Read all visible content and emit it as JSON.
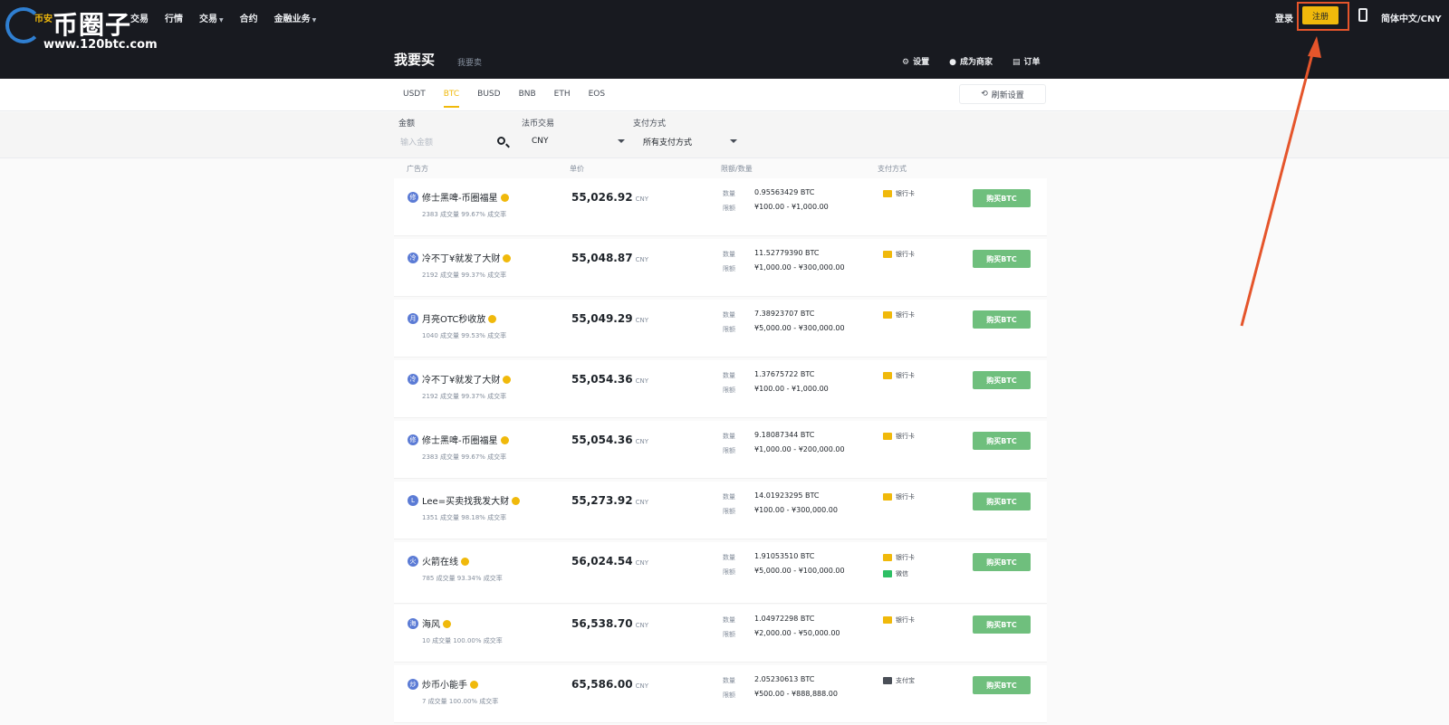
{
  "header": {
    "watermark": {
      "site_name": "币圈子",
      "url": "www.120btc.com",
      "logo_fragment": "币安"
    },
    "nav": [
      {
        "label": "交易",
        "has_caret": false
      },
      {
        "label": "行情",
        "has_caret": false
      },
      {
        "label": "交易",
        "has_caret": true
      },
      {
        "label": "合约",
        "has_caret": false
      },
      {
        "label": "金融业务",
        "has_caret": true
      }
    ],
    "login_label": "登录",
    "register_label": "注册",
    "language_label": "简体中文/CNY",
    "highlight_color": "#e5552b"
  },
  "subheader": {
    "title": "我要买",
    "sell_tab": "我要卖",
    "settings_label": "设置",
    "merchant_label": "成为商家",
    "orders_label": "订单"
  },
  "tabs": {
    "items": [
      "USDT",
      "BTC",
      "BUSD",
      "BNB",
      "ETH",
      "EOS"
    ],
    "active": "BTC",
    "refresh_label": "刷新设置"
  },
  "filters": {
    "amount_label": "金额",
    "amount_placeholder": "输入金额",
    "fiat_label": "法币交易",
    "fiat_value": "CNY",
    "payment_label": "支付方式",
    "payment_value": "所有支付方式"
  },
  "table": {
    "headers": [
      "广告方",
      "单价",
      "限额/数量",
      "支付方式"
    ],
    "currency": "CNY",
    "qty_label": "数量",
    "limit_label": "限额",
    "buy_label": "购买BTC",
    "rows": [
      {
        "avatar": "修",
        "name": "修士黑啤-币圈福星",
        "stats": "2383 成交量  99.67% 成交率",
        "price": "55,026.92",
        "qty": "0.95563429 BTC",
        "limit": "¥100.00 - ¥1,000.00",
        "payments": [
          {
            "name": "银行卡",
            "icon": "bank-card"
          }
        ]
      },
      {
        "avatar": "冷",
        "name": "冷不丁¥就发了大财",
        "stats": "2192 成交量  99.37% 成交率",
        "price": "55,048.87",
        "qty": "11.52779390 BTC",
        "limit": "¥1,000.00 - ¥300,000.00",
        "payments": [
          {
            "name": "银行卡",
            "icon": "bank-card"
          }
        ]
      },
      {
        "avatar": "月",
        "name": "月亮OTC秒收放",
        "stats": "1040 成交量  99.53% 成交率",
        "price": "55,049.29",
        "qty": "7.38923707 BTC",
        "limit": "¥5,000.00 - ¥300,000.00",
        "payments": [
          {
            "name": "银行卡",
            "icon": "bank-card"
          }
        ]
      },
      {
        "avatar": "冷",
        "name": "冷不丁¥就发了大财",
        "stats": "2192 成交量  99.37% 成交率",
        "price": "55,054.36",
        "qty": "1.37675722 BTC",
        "limit": "¥100.00 - ¥1,000.00",
        "payments": [
          {
            "name": "银行卡",
            "icon": "bank-card"
          }
        ]
      },
      {
        "avatar": "修",
        "name": "修士黑啤-币圈福星",
        "stats": "2383 成交量  99.67% 成交率",
        "price": "55,054.36",
        "qty": "9.18087344 BTC",
        "limit": "¥1,000.00 - ¥200,000.00",
        "payments": [
          {
            "name": "银行卡",
            "icon": "bank-card"
          }
        ]
      },
      {
        "avatar": "L",
        "name": "Lee=买卖找我发大财",
        "stats": "1351 成交量  98.18% 成交率",
        "price": "55,273.92",
        "qty": "14.01923295 BTC",
        "limit": "¥100.00 - ¥300,000.00",
        "payments": [
          {
            "name": "银行卡",
            "icon": "bank-card"
          }
        ]
      },
      {
        "avatar": "火",
        "name": "火箭在线",
        "stats": "785 成交量  93.34% 成交率",
        "price": "56,024.54",
        "qty": "1.91053510 BTC",
        "limit": "¥5,000.00 - ¥100,000.00",
        "payments": [
          {
            "name": "银行卡",
            "icon": "bank-card"
          },
          {
            "name": "微信",
            "icon": "wechat"
          }
        ]
      },
      {
        "avatar": "海",
        "name": "海风",
        "stats": "10 成交量  100.00% 成交率",
        "price": "56,538.70",
        "qty": "1.04972298 BTC",
        "limit": "¥2,000.00 - ¥50,000.00",
        "payments": [
          {
            "name": "银行卡",
            "icon": "bank-card"
          }
        ]
      },
      {
        "avatar": "炒",
        "name": "炒币小能手",
        "stats": "7 成交量  100.00% 成交率",
        "price": "65,586.00",
        "qty": "2.05230613 BTC",
        "limit": "¥500.00 - ¥888,888.00",
        "payments": [
          {
            "name": "支付宝",
            "icon": "alipay"
          }
        ]
      }
    ]
  },
  "colors": {
    "accent": "#f0b90b",
    "buy_button": "#6fbf7d",
    "topbar": "#181a20",
    "annotation_arrow": "#e5552b"
  }
}
